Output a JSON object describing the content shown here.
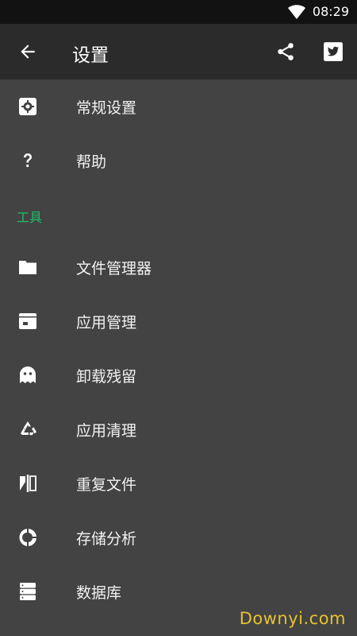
{
  "status_bar": {
    "time": "08:29",
    "wifi_icon": "wifi-icon"
  },
  "app_bar": {
    "title": "设置",
    "back_icon": "arrow-back-icon",
    "share_icon": "share-icon",
    "twitter_icon": "twitter-icon"
  },
  "menu": {
    "general_settings": "常规设置",
    "help": "帮助",
    "tools_section": "工具",
    "file_manager": "文件管理器",
    "app_manager": "应用管理",
    "uninstall_residue": "卸载残留",
    "app_cleaner": "应用清理",
    "duplicate_files": "重复文件",
    "storage_analysis": "存储分析",
    "database": "数据库"
  },
  "colors": {
    "background": "#434343",
    "app_bar": "#2b2b2b",
    "status_bar": "#121212",
    "section_accent": "#1fbf6a",
    "watermark": "#e6c230"
  },
  "watermark": "Downyi.com"
}
